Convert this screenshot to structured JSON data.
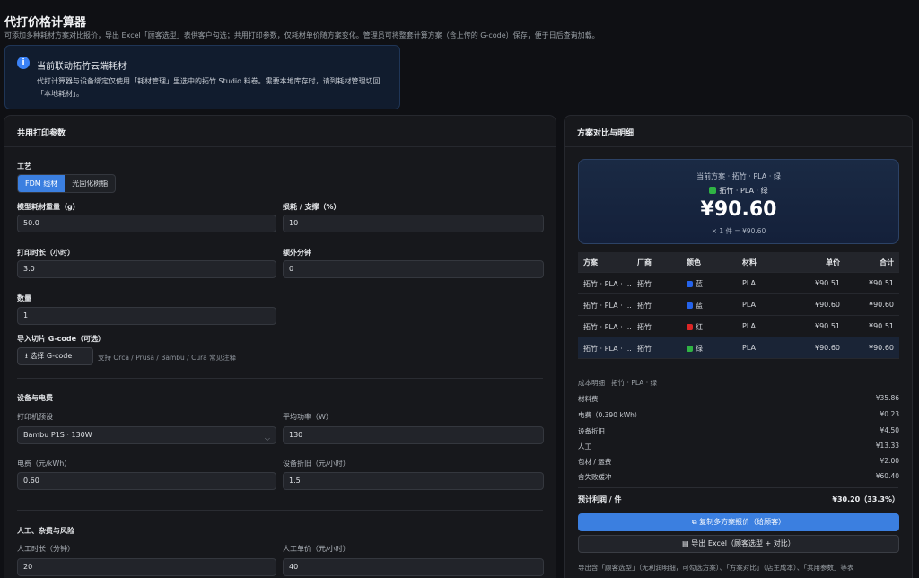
{
  "page": {
    "title": "代打价格计算器",
    "description": "可添加多种耗材方案对比报价，导出 Excel「顾客选型」表供客户勾选；共用打印参数，仅耗材单价随方案变化。管理员可将整套计算方案（含上传的 G-code）保存，便于日后查询加载。"
  },
  "notice": {
    "icon": "info-icon",
    "title": "当前联动拓竹云端耗材",
    "body": "代打计算器与设备绑定仅使用「耗材管理」里选中的拓竹 Studio 料卷。需要本地库存时，请到耗材管理切回「本地耗材」。"
  },
  "left": {
    "title": "共用打印参数",
    "process": {
      "label": "工艺",
      "options": [
        "FDM 线材",
        "光固化树脂"
      ],
      "selected": "FDM 线材"
    },
    "model_weight": {
      "label": "模型耗材重量（g）",
      "value": "50.0"
    },
    "loss": {
      "label": "损耗 / 支撑（%）",
      "value": "10"
    },
    "print_time": {
      "label": "打印时长（小时）",
      "value": "3.0"
    },
    "extra_minutes": {
      "label": "额外分钟",
      "value": "0"
    },
    "quantity": {
      "label": "数量",
      "value": "1"
    },
    "gcode": {
      "label": "导入切片 G-code（可选）",
      "button": "选择 G-code",
      "hint": "支持 Orca / Prusa / Bambu / Cura 常见注释"
    },
    "equipment": {
      "section": "设备与电费",
      "printer_label": "打印机预设",
      "printer_value": "Bambu P1S · 130W",
      "power_label": "平均功率（W）",
      "power_value": "130",
      "elec_label": "电费（元/kWh）",
      "elec_value": "0.60",
      "depr_label": "设备折旧（元/小时）",
      "depr_value": "1.5"
    },
    "labor": {
      "section": "人工、杂费与风险",
      "time_label": "人工时长（分钟）",
      "time_value": "20",
      "rate_label": "人工单价（元/小时）",
      "rate_value": "40"
    }
  },
  "right": {
    "title": "方案对比与明细",
    "summary": {
      "current": "当前方案 · 拓竹 · PLA · 绿",
      "swatch_label": "拓竹 · PLA · 绿",
      "price": "¥90.60",
      "per_item": "× 1 件 = ¥90.60"
    },
    "table": {
      "headers": [
        "方案",
        "厂商",
        "颜色",
        "材料",
        "单价",
        "合计"
      ],
      "rows": [
        {
          "plan": "拓竹 · PLA · ...",
          "vendor": "拓竹",
          "color": "蓝",
          "color_hex": "#2563eb",
          "material": "PLA",
          "unit": "¥90.51",
          "total": "¥90.51"
        },
        {
          "plan": "拓竹 · PLA · ...",
          "vendor": "拓竹",
          "color": "蓝",
          "color_hex": "#2563eb",
          "material": "PLA",
          "unit": "¥90.60",
          "total": "¥90.60"
        },
        {
          "plan": "拓竹 · PLA · ...",
          "vendor": "拓竹",
          "color": "红",
          "color_hex": "#dc2626",
          "material": "PLA",
          "unit": "¥90.51",
          "total": "¥90.51"
        },
        {
          "plan": "拓竹 · PLA · ...",
          "vendor": "拓竹",
          "color": "绿",
          "color_hex": "#2fb344",
          "material": "PLA",
          "unit": "¥90.60",
          "total": "¥90.60"
        }
      ]
    },
    "breakdown": {
      "title": "成本明细 · 拓竹 · PLA · 绿",
      "items": [
        {
          "label": "材料费",
          "value": "¥35.86"
        },
        {
          "label": "电费（0.390 kWh）",
          "value": "¥0.23"
        },
        {
          "label": "设备折旧",
          "value": "¥4.50"
        },
        {
          "label": "人工",
          "value": "¥13.33"
        },
        {
          "label": "包材 / 运费",
          "value": "¥2.00"
        },
        {
          "label": "含失败缓冲",
          "value": "¥60.40"
        }
      ],
      "profit_label": "预计利润 / 件",
      "profit_value": "¥30.20（33.3%）"
    },
    "copy_button": "复制多方案报价（给顾客）",
    "export_button": "导出 Excel（顾客选型 + 对比）",
    "footnote": "导出含「顾客选型」（无利润明细，可勾选方案）、「方案对比」（店主成本）、「共用参数」等表"
  }
}
